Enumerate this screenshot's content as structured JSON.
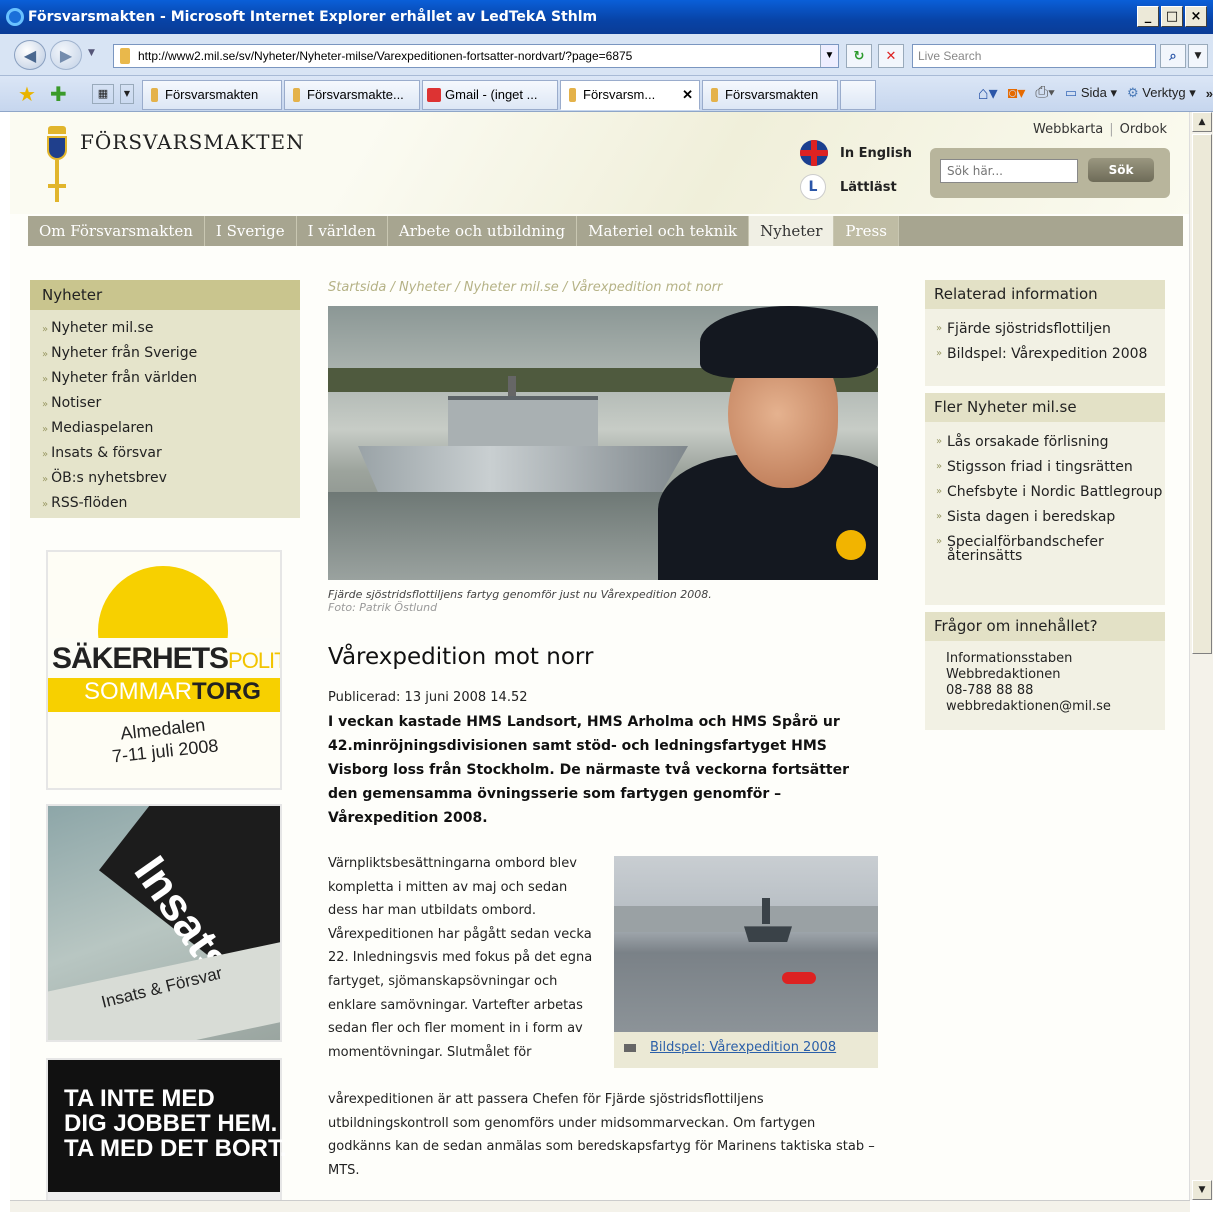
{
  "window": {
    "title": "Försvarsmakten - Microsoft Internet Explorer erhållet av LedTekA Sthlm"
  },
  "address": {
    "url": "http://www2.mil.se/sv/Nyheter/Nyheter-milse/Varexpeditionen-fortsatter-nordvart/?page=6875",
    "search_placeholder": "Live Search"
  },
  "tabs": [
    "Försvarsmakten",
    "Försvarsmakte...",
    "Gmail - (inget ...",
    "Försvarsm...",
    "Försvarsmakten"
  ],
  "toolbar": {
    "page": "Sida",
    "tools": "Verktyg"
  },
  "site": {
    "name": "FÖRSVARSMAKTEN",
    "toplinks": [
      "Webbkarta",
      "Ordbok"
    ],
    "lang_english": "In English",
    "lang_easy": "Lättläst",
    "search_placeholder": "Sök här...",
    "search_button": "Sök",
    "nav": [
      "Om Försvarsmakten",
      "I Sverige",
      "I världen",
      "Arbete och utbildning",
      "Materiel och teknik",
      "Nyheter",
      "Press"
    ]
  },
  "leftmenu": {
    "title": "Nyheter",
    "items": [
      "Nyheter mil.se",
      "Nyheter från Sverige",
      "Nyheter från världen",
      "Notiser",
      "Mediaspelaren",
      "Insats & försvar",
      "ÖB:s nyhetsbrev",
      "RSS-flöden"
    ]
  },
  "banners": {
    "b1_main": "SÄKERHETS",
    "b1_politiskt": "POLITISKT",
    "b1_sommar": "SOMMAR",
    "b1_torg": "TORG",
    "b1_place": "Almedalen",
    "b1_dates": "7-11 juli 2008",
    "b2_word": "Insats",
    "b2_label": "Insats & Försvar",
    "b3_text": "TA INTE MED\nDIG JOBBET HEM.\nTA MED DET BORT."
  },
  "article": {
    "breadcrumb": "Startsida / Nyheter / Nyheter mil.se / Vårexpedition mot norr",
    "caption": "Fjärde sjöstridsflottiljens fartyg genomför just nu Vårexpedition 2008.",
    "photo": "Foto: Patrik Östlund",
    "title": "Vårexpedition mot norr",
    "published": "Publicerad: 13 juni 2008 14.52",
    "ingress": "I veckan kastade HMS Landsort, HMS Arholma och HMS Spårö ur 42.minröjningsdivisionen samt stöd- och ledningsfartyget HMS Visborg loss från Stockholm. De närmaste två veckorna fortsätter den gemensamma övningsserie som fartygen genomför – Vårexpedition 2008.",
    "body1": "Värnpliktsbesättningarna ombord blev kompletta i mitten av maj och sedan dess har man utbildats ombord. Vårexpeditionen har pågått sedan vecka 22. Inledningsvis med fokus på det egna fartyget, sjömanskapsövningar och enklare samövningar. Vartefter arbetas sedan fler och fler moment in i form av momentövningar. Slutmålet för",
    "body2": "vårexpeditionen är att passera Chefen för Fjärde sjöstridsflottiljens utbildningskontroll som genomförs under midsommarveckan. Om fartygen godkänns kan de sedan anmälas som beredskapsfartyg för Marinens taktiska stab – MTS.",
    "figure_link": "Bildspel: Vårexpedition 2008"
  },
  "right": {
    "related_title": "Relaterad information",
    "related": [
      "Fjärde sjöstridsflottiljen",
      "Bildspel: Vårexpedition 2008"
    ],
    "more_title": "Fler Nyheter mil.se",
    "more": [
      "Lås orsakade förlisning",
      "Stigsson friad i tingsrätten",
      "Chefsbyte i Nordic Battlegroup",
      "Sista dagen i beredskap",
      "Specialförbandschefer återinsätts"
    ],
    "questions_title": "Frågor om innehållet?",
    "contact": [
      "Informationsstaben",
      "Webbredaktionen",
      "08-788 88 88",
      "webbredaktionen@mil.se"
    ]
  }
}
